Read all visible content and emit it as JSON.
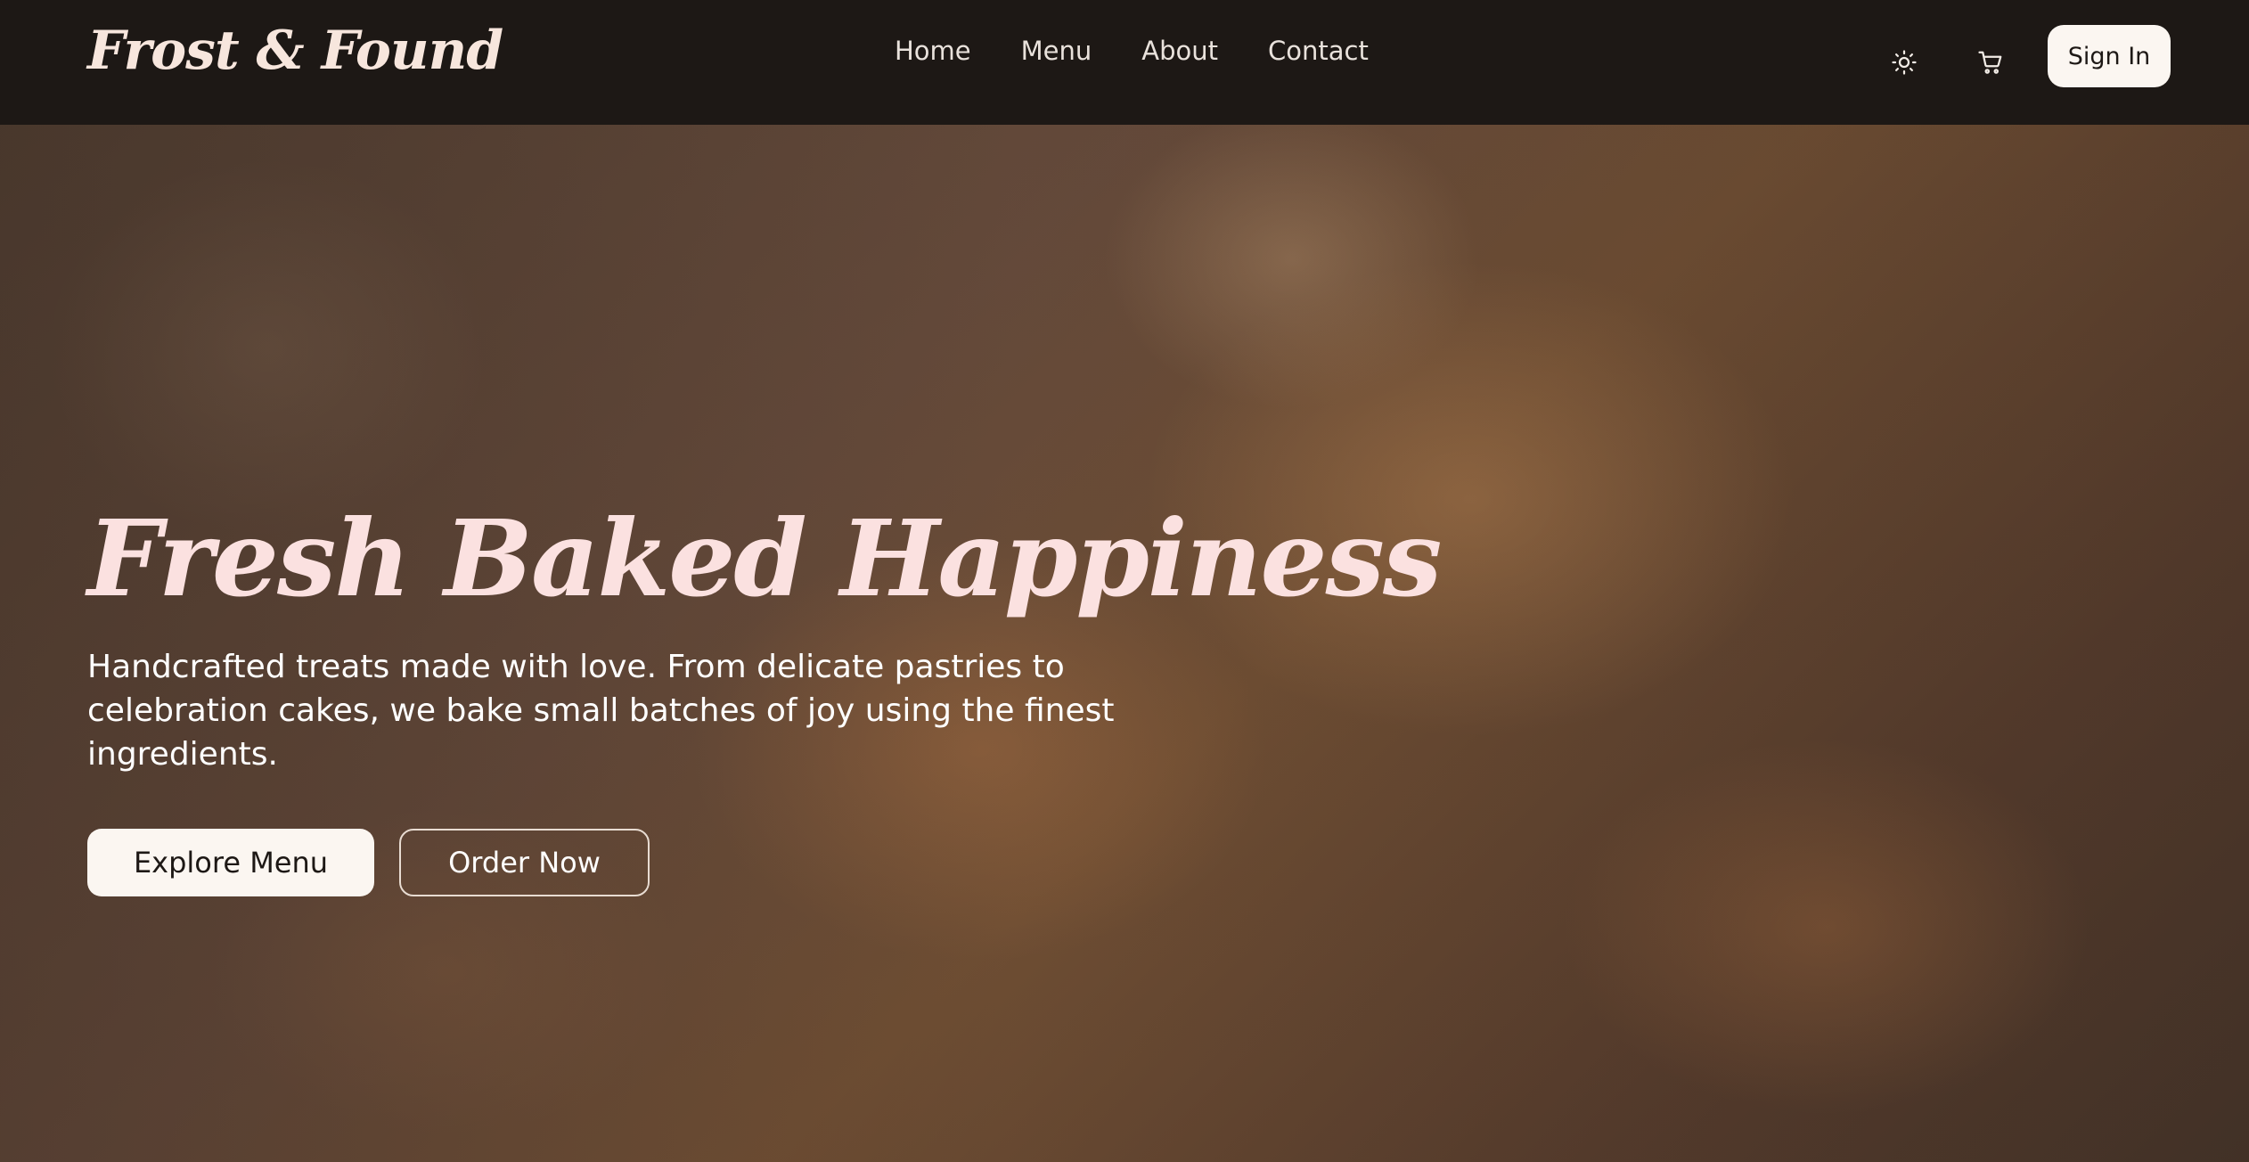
{
  "header": {
    "brand": "Frost & Found",
    "nav": [
      {
        "label": "Home"
      },
      {
        "label": "Menu"
      },
      {
        "label": "About"
      },
      {
        "label": "Contact"
      }
    ],
    "icons": {
      "theme": "sun-icon",
      "cart": "cart-icon"
    },
    "signin_label": "Sign In"
  },
  "hero": {
    "title": "Fresh Baked Happiness",
    "description": "Handcrafted treats made with love. From delicate pastries to celebration cakes, we bake small batches of joy using the finest ingredients.",
    "primary_button": "Explore Menu",
    "secondary_button": "Order Now"
  },
  "colors": {
    "header_bg": "#1d1815",
    "title_pink": "#fbe1e0",
    "button_light": "#fbf6f1"
  }
}
